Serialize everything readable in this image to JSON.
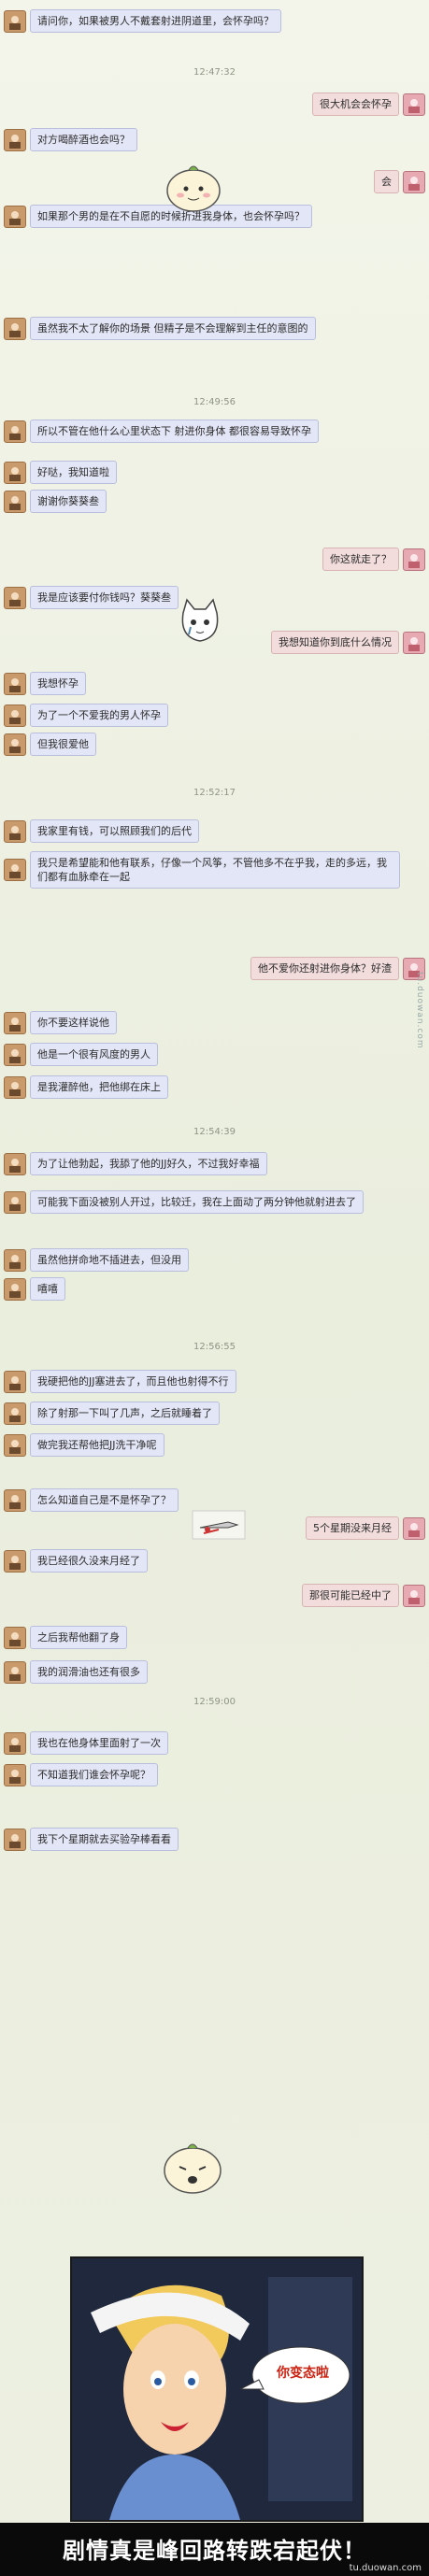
{
  "messages": [
    {
      "side": "left",
      "text": "请问你，如果被男人不戴套射进阴道里，会怀孕吗？"
    },
    {
      "side": "time",
      "text": "12:47:32"
    },
    {
      "side": "right",
      "text": "很大机会会怀孕"
    },
    {
      "side": "left",
      "text": "对方喝醉酒也会吗？"
    },
    {
      "side": "right",
      "text": "会"
    },
    {
      "side": "left",
      "text": "如果那个男的是在不自愿的时候折进我身体，也会怀孕吗？"
    },
    {
      "side": "left",
      "text": "虽然我不太了解你的场景 但精子是不会理解到主任的意图的"
    },
    {
      "side": "time",
      "text": "12:49:56"
    },
    {
      "side": "left",
      "text": "所以不管在他什么心里状态下 射进你身体 都很容易导致怀孕"
    },
    {
      "side": "left",
      "text": "好哒，我知道啦"
    },
    {
      "side": "left",
      "text": "谢谢你葵葵叁"
    },
    {
      "side": "right",
      "text": "你这就走了？"
    },
    {
      "side": "left",
      "text": "我是应该要付你钱吗？葵葵叁"
    },
    {
      "side": "right",
      "text": "我想知道你到底什么情况"
    },
    {
      "side": "left",
      "text": "我想怀孕"
    },
    {
      "side": "left",
      "text": "为了一个不爱我的男人怀孕"
    },
    {
      "side": "left",
      "text": "但我很爱他"
    },
    {
      "side": "time",
      "text": "12:52:17"
    },
    {
      "side": "left",
      "text": "我家里有钱，可以照顾我们的后代"
    },
    {
      "side": "left",
      "text": "我只是希望能和他有联系，仔像一个风筝，不管他多不在乎我，走的多远，我们都有血脉牵在一起"
    },
    {
      "side": "right",
      "text": "他不爱你还射进你身体？好渣"
    },
    {
      "side": "left",
      "text": "你不要这样说他"
    },
    {
      "side": "left",
      "text": "他是一个很有风度的男人"
    },
    {
      "side": "left",
      "text": "是我灌醉他，把他绑在床上"
    },
    {
      "side": "time",
      "text": "12:54:39"
    },
    {
      "side": "left",
      "text": "为了让他勃起，我舔了他的JJ好久，不过我好幸福"
    },
    {
      "side": "left",
      "text": "可能我下面没被别人开过，比较迁，我在上面动了两分钟他就射进去了"
    },
    {
      "side": "left",
      "text": "虽然他拼命地不插进去，但没用"
    },
    {
      "side": "left",
      "text": "嘻嘻"
    },
    {
      "side": "time",
      "text": "12:56:55"
    },
    {
      "side": "left",
      "text": "我硬把他的JJ塞进去了，而且他也射得不行"
    },
    {
      "side": "left",
      "text": "除了射那一下叫了几声，之后就睡着了"
    },
    {
      "side": "left",
      "text": "做完我还帮他把JJ洗干净呢"
    },
    {
      "side": "left",
      "text": "怎么知道自己是不是怀孕了？"
    },
    {
      "side": "right",
      "text": "5个星期没来月经"
    },
    {
      "side": "left",
      "text": "我已经很久没来月经了"
    },
    {
      "side": "right",
      "text": "那很可能已经中了"
    },
    {
      "side": "left",
      "text": "之后我帮他翻了身"
    },
    {
      "side": "left",
      "text": "我的润滑油也还有很多"
    },
    {
      "side": "time",
      "text": "12:59:00"
    },
    {
      "side": "left",
      "text": "我也在他身体里面射了一次"
    },
    {
      "side": "left",
      "text": "不知道我们谁会怀孕呢？"
    },
    {
      "side": "left",
      "text": "我下个星期就去买验孕棒看看"
    }
  ],
  "cartoon": {
    "speech": "你变态啦"
  },
  "banner": {
    "text": "剧情真是峰回路转跌宕起伏！",
    "site": "tu.duowan.com"
  },
  "watermark": {
    "side_text": "tu.duowan.com"
  },
  "colors": {
    "left_bubble": "#e3e6f6",
    "right_bubble": "#f2dcdc",
    "banner_bg": "#0a0a0a"
  }
}
